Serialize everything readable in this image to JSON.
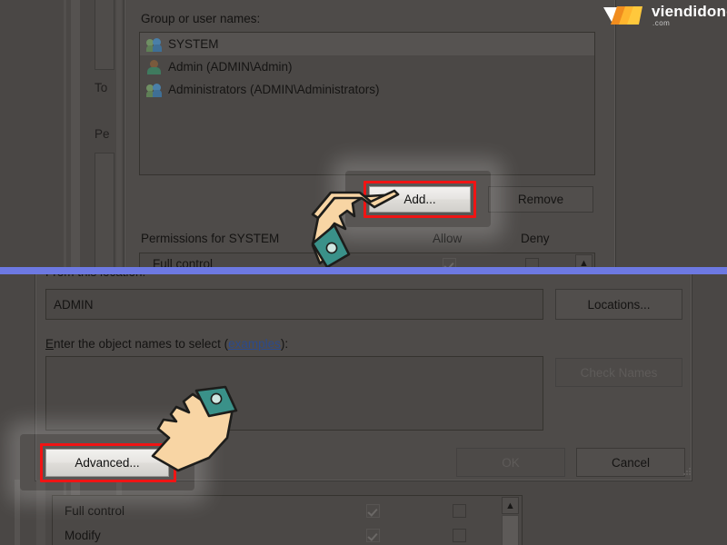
{
  "watermark": {
    "brand": "viendidong",
    "suffix": ".com",
    "colors": {
      "orange_dark": "#f08c1e",
      "orange_light": "#ffc83c",
      "triangle": "#ffffff",
      "text": "#ffffff"
    }
  },
  "accent": {
    "highlight_red": "#f01414",
    "divider_blue": "#6d79e2"
  },
  "security_dialog": {
    "group_label": "Group or user names:",
    "entries": [
      {
        "name": "SYSTEM",
        "icon": "users-group-icon",
        "selected": true
      },
      {
        "name": "Admin (ADMIN\\Admin)",
        "icon": "user-icon",
        "selected": false
      },
      {
        "name": "Administrators (ADMIN\\Administrators)",
        "icon": "users-group-icon",
        "selected": false
      }
    ],
    "add_button": "Add...",
    "remove_button": "Remove",
    "permissions_label": "Permissions for SYSTEM",
    "allow_header": "Allow",
    "deny_header": "Deny",
    "permission_rows": [
      {
        "name": "Full control",
        "allow": true,
        "deny": false
      }
    ],
    "clipped_left_labels": [
      "To",
      "Pe"
    ]
  },
  "select_users_dialog": {
    "from_location_label": "From this location:",
    "location_value": "ADMIN",
    "locations_button": "Locations...",
    "enter_names_label_before": "Enter the object names to select (",
    "enter_names_link": "examples",
    "enter_names_label_after": "):",
    "names_value": "",
    "check_names_button": "Check Names",
    "check_names_enabled": false,
    "advanced_button": "Advanced...",
    "ok_button": "OK",
    "ok_enabled": false,
    "cancel_button": "Cancel"
  },
  "background_permissions": {
    "rows": [
      {
        "name": "Full control",
        "allow": true,
        "deny": false
      },
      {
        "name": "Modify",
        "allow": true,
        "deny": false
      }
    ]
  },
  "annotations": {
    "highlight_add": "Add...",
    "highlight_advanced": "Advanced...",
    "cursor_1": "pointing-hand-up-right",
    "cursor_2": "pointing-hand-down-left"
  }
}
